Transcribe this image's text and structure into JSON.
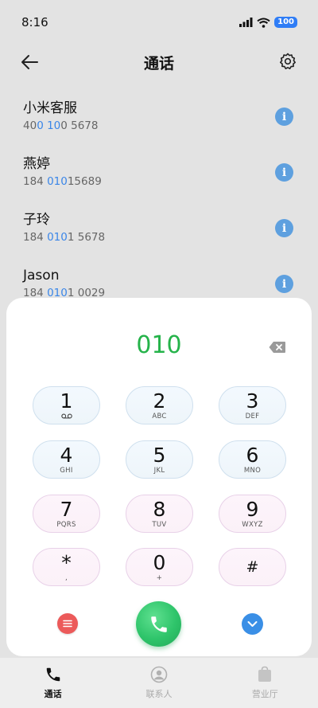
{
  "status": {
    "time": "8:16",
    "battery": "100"
  },
  "header": {
    "title": "通话"
  },
  "contacts": [
    {
      "name": "小米客服",
      "num_pre": "40",
      "num_hl1": "0 10",
      "num_mid": "0 5678",
      "num_hl2": "",
      "num_post": ""
    },
    {
      "name": "燕婷",
      "num_pre": "184 ",
      "num_hl1": "010",
      "num_mid": "15689",
      "num_hl2": "",
      "num_post": ""
    },
    {
      "name": "子玲",
      "num_pre": "184 ",
      "num_hl1": "010",
      "num_mid": "1 5678",
      "num_hl2": "",
      "num_post": ""
    },
    {
      "name": "Jason",
      "num_pre": "184 ",
      "num_hl1": "010",
      "num_mid": "1 0029",
      "num_hl2": "",
      "num_post": ""
    }
  ],
  "dialer": {
    "input": "010",
    "keys": [
      {
        "digit": "1",
        "letters": "",
        "sub_icon": "voicemail-icon"
      },
      {
        "digit": "2",
        "letters": "ABC"
      },
      {
        "digit": "3",
        "letters": "DEF"
      },
      {
        "digit": "4",
        "letters": "GHI"
      },
      {
        "digit": "5",
        "letters": "JKL"
      },
      {
        "digit": "6",
        "letters": "MNO"
      },
      {
        "digit": "7",
        "letters": "PQRS"
      },
      {
        "digit": "8",
        "letters": "TUV"
      },
      {
        "digit": "9",
        "letters": "WXYZ"
      },
      {
        "digit": "*",
        "letters": ","
      },
      {
        "digit": "0",
        "letters": "+"
      },
      {
        "digit": "#",
        "letters": ""
      }
    ]
  },
  "nav": {
    "items": [
      {
        "label": "通话",
        "icon": "phone-icon",
        "active": true
      },
      {
        "label": "联系人",
        "icon": "person-icon",
        "active": false
      },
      {
        "label": "营业厅",
        "icon": "shopping-bag-icon",
        "active": false
      }
    ]
  },
  "colors": {
    "accent_green": "#25b34a",
    "highlight_blue": "#3a86e8",
    "info_blue": "#5ea0df",
    "menu_red": "#ec5a5a"
  }
}
